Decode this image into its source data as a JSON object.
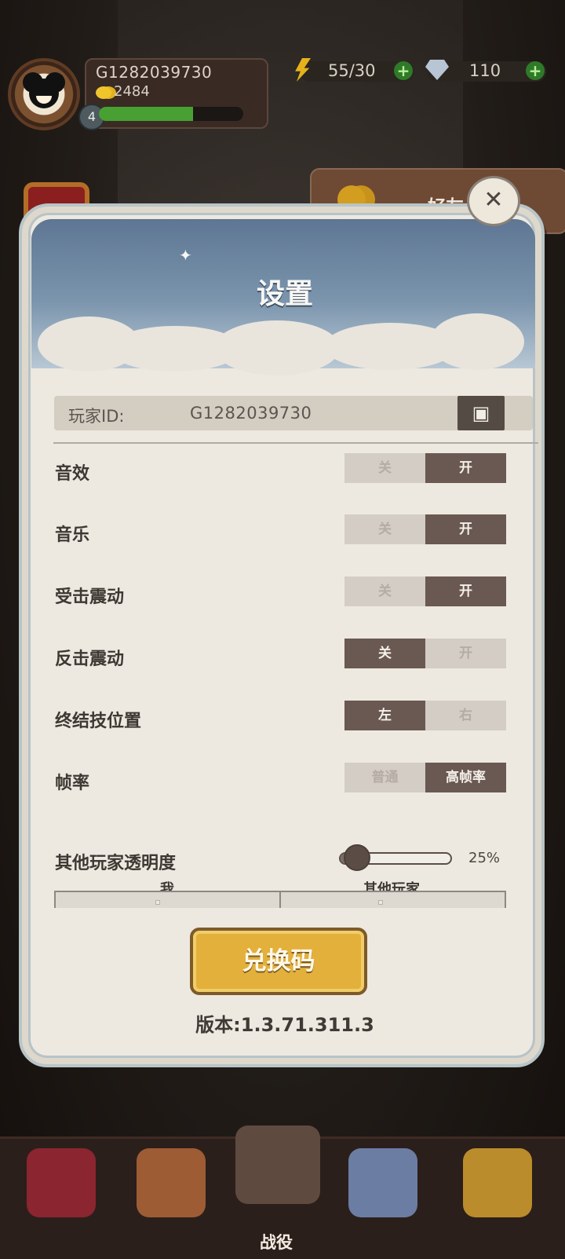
{
  "hud": {
    "player_id": "G1282039730",
    "coins": "2484",
    "level": "4",
    "xp_progress": 0.65,
    "energy": "55/30",
    "gems": "110"
  },
  "side": {
    "friends_tab": "好友"
  },
  "dialog": {
    "title": "设置",
    "player_id_label": "玩家ID:",
    "player_id_value": "G1282039730",
    "settings": [
      {
        "label": "音效",
        "left": "关",
        "right": "开",
        "selected": "right"
      },
      {
        "label": "音乐",
        "left": "关",
        "right": "开",
        "selected": "right"
      },
      {
        "label": "受击震动",
        "left": "关",
        "right": "开",
        "selected": "right"
      },
      {
        "label": "反击震动",
        "left": "关",
        "right": "开",
        "selected": "left"
      },
      {
        "label": "终结技位置",
        "left": "左",
        "right": "右",
        "selected": "left"
      },
      {
        "label": "帧率",
        "left": "普通",
        "right": "高帧率",
        "selected": "right"
      }
    ],
    "transparency": {
      "label": "其他玩家透明度",
      "value": "25%"
    },
    "subtabs": {
      "me": "我",
      "others": "其他玩家"
    },
    "redeem_button": "兑换码",
    "version": "版本:1.3.71.311.3"
  },
  "bottom_nav": {
    "battle_label": "战役"
  },
  "colors": {
    "active_toggle": "#6a5852",
    "inactive_toggle": "#d3cdc6",
    "redeem_button": "#e3b03c"
  }
}
